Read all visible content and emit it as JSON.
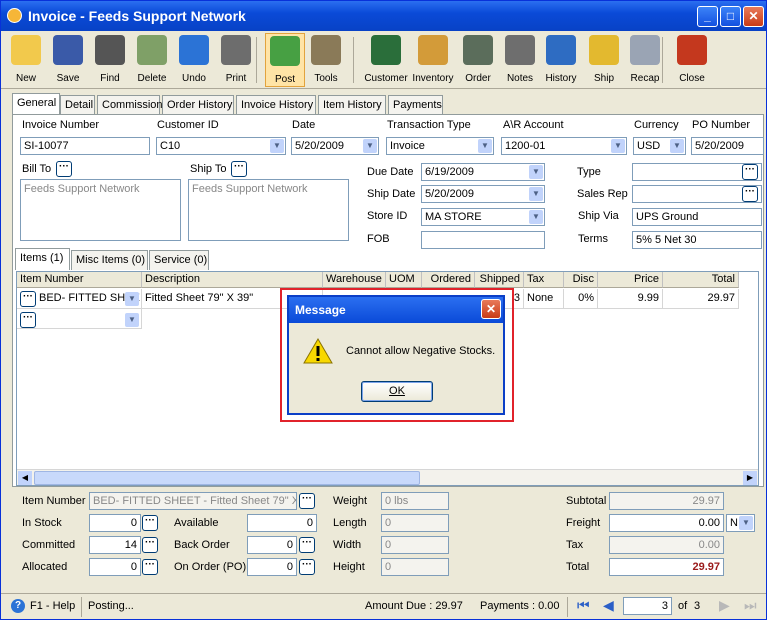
{
  "window": {
    "title": "Invoice - Feeds Support Network",
    "minimize": "_",
    "maximize": "□",
    "close": "✕"
  },
  "toolbar": {
    "items": [
      {
        "label": "New",
        "icon": "new-document-icon",
        "color": "#f2c94c"
      },
      {
        "label": "Save",
        "icon": "floppy-disk-icon",
        "color": "#3a5aa8"
      },
      {
        "label": "Find",
        "icon": "binoculars-icon",
        "color": "#555555"
      },
      {
        "label": "Delete",
        "icon": "recycle-bin-icon",
        "color": "#7fa067"
      },
      {
        "label": "Undo",
        "icon": "undo-arrow-icon",
        "color": "#2b73d6"
      },
      {
        "label": "Print",
        "icon": "printer-icon",
        "color": "#6d6d6d"
      },
      {
        "label": "Post",
        "icon": "post-checkmark-icon",
        "color": "#47a043"
      },
      {
        "label": "Tools",
        "icon": "tools-icon",
        "color": "#8a7a58"
      },
      {
        "label": "Customer",
        "icon": "customer-person-icon",
        "color": "#2a6e3a"
      },
      {
        "label": "Inventory",
        "icon": "inventory-boxes-icon",
        "color": "#d39b39"
      },
      {
        "label": "Order",
        "icon": "order-handheld-icon",
        "color": "#5b6d5b"
      },
      {
        "label": "Notes",
        "icon": "notes-notebook-icon",
        "color": "#6e6e6e"
      },
      {
        "label": "History",
        "icon": "history-person-icon",
        "color": "#2e6cc2"
      },
      {
        "label": "Ship",
        "icon": "ship-forklift-icon",
        "color": "#e3b92f"
      },
      {
        "label": "Recap",
        "icon": "recap-document-icon",
        "color": "#9aa4b4"
      },
      {
        "label": "Close",
        "icon": "close-window-icon",
        "color": "#c4381e"
      }
    ]
  },
  "tabs": [
    "General",
    "Detail",
    "Commission",
    "Order History",
    "Invoice History",
    "Item History",
    "Payments"
  ],
  "form": {
    "invoice_number_label": "Invoice Number",
    "invoice_number": "SI-10077",
    "customer_id_label": "Customer ID",
    "customer_id": "C10",
    "date_label": "Date",
    "date": "5/20/2009",
    "transaction_type_label": "Transaction Type",
    "transaction_type": "Invoice",
    "ar_account_label": "A\\R Account",
    "ar_account": "1200-01",
    "currency_label": "Currency",
    "currency": "USD",
    "po_number_label": "PO Number",
    "po_number": "5/20/2009",
    "bill_to_label": "Bill To",
    "bill_to": "Feeds Support Network",
    "ship_to_label": "Ship To",
    "ship_to": "Feeds Support Network",
    "due_date_label": "Due Date",
    "due_date": "6/19/2009",
    "ship_date_label": "Ship Date",
    "ship_date": "5/20/2009",
    "store_id_label": "Store ID",
    "store_id": "MA STORE",
    "fob_label": "FOB",
    "fob": "",
    "type_label": "Type",
    "type": "",
    "sales_rep_label": "Sales Rep",
    "sales_rep": "",
    "ship_via_label": "Ship Via",
    "ship_via": "UPS Ground",
    "terms_label": "Terms",
    "terms": "5% 5 Net 30"
  },
  "subtabs": [
    "Items (1)",
    "Misc Items (0)",
    "Service (0)"
  ],
  "grid": {
    "headers": [
      "Item Number",
      "Description",
      "Warehouse",
      "UOM",
      "Ordered",
      "Shipped",
      "Tax",
      "Disc",
      "Price",
      "Total"
    ],
    "rows": [
      {
        "item": "BED- FITTED SHEE",
        "description": "Fitted Sheet 79\" X 39\"",
        "shipped": "3",
        "tax": "None",
        "disc": "0%",
        "price": "9.99",
        "total": "29.97"
      }
    ]
  },
  "dialog": {
    "title": "Message",
    "message": "Cannot allow Negative Stocks.",
    "ok": "OK"
  },
  "bottom": {
    "item_number_label": "Item Number",
    "item_number": "BED- FITTED SHEET - Fitted Sheet 79\" X 3",
    "in_stock_label": "In Stock",
    "in_stock": "0",
    "committed_label": "Committed",
    "committed": "14",
    "allocated_label": "Allocated",
    "allocated": "0",
    "available_label": "Available",
    "available": "0",
    "back_order_label": "Back Order",
    "back_order": "0",
    "on_order_label": "On Order (PO)",
    "on_order": "0",
    "weight_label": "Weight",
    "weight": "0 lbs",
    "length_label": "Length",
    "length": "0",
    "width_label": "Width",
    "width": "0",
    "height_label": "Height",
    "height": "0",
    "subtotal_label": "Subtotal",
    "subtotal": "29.97",
    "freight_label": "Freight",
    "freight": "0.00",
    "freight_unit": "N",
    "tax_label": "Tax",
    "tax": "0.00",
    "total_label": "Total",
    "total": "29.97"
  },
  "status": {
    "help": "F1 - Help",
    "state": "Posting...",
    "amount_due": "Amount Due : 29.97",
    "payments": "Payments : 0.00",
    "page": "3",
    "of": "of",
    "pages": "3"
  }
}
